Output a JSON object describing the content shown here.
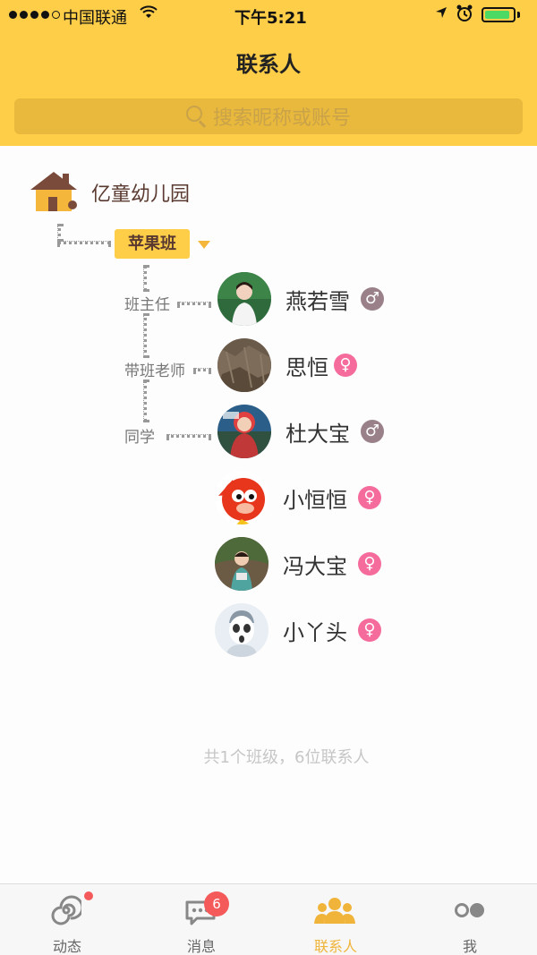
{
  "status_bar": {
    "carrier": "中国联通",
    "time": "下午5:21",
    "battery_percent": 90
  },
  "nav": {
    "title": "联系人"
  },
  "search": {
    "placeholder": "搜索昵称或账号"
  },
  "school": {
    "name": "亿童幼儿园"
  },
  "class": {
    "name": "苹果班"
  },
  "roles": {
    "head_teacher": "班主任",
    "class_teacher": "带班老师",
    "classmate": "同学"
  },
  "contacts": [
    {
      "name": "燕若雪",
      "gender": "male",
      "gender_symbol": "♂"
    },
    {
      "name": "思恒",
      "gender": "female",
      "gender_symbol": "♀"
    },
    {
      "name": "杜大宝",
      "gender": "male",
      "gender_symbol": "♂"
    },
    {
      "name": "小恒恒",
      "gender": "female",
      "gender_symbol": "♀"
    },
    {
      "name": "冯大宝",
      "gender": "female",
      "gender_symbol": "♀"
    },
    {
      "name": "小丫头",
      "gender": "female",
      "gender_symbol": "♀"
    }
  ],
  "summary": "共1个班级，6位联系人",
  "tabbar": {
    "items": [
      {
        "label": "动态",
        "icon": "spiral-icon"
      },
      {
        "label": "消息",
        "icon": "chat-bubble-icon",
        "badge": "6"
      },
      {
        "label": "联系人",
        "icon": "people-icon"
      },
      {
        "label": "我",
        "icon": "profile-dots-icon"
      }
    ]
  },
  "colors": {
    "primary": "#fece49",
    "active_tab": "#f0b43a",
    "male": "#9a8088",
    "female": "#f46b9c",
    "badge": "#f45a5a"
  }
}
